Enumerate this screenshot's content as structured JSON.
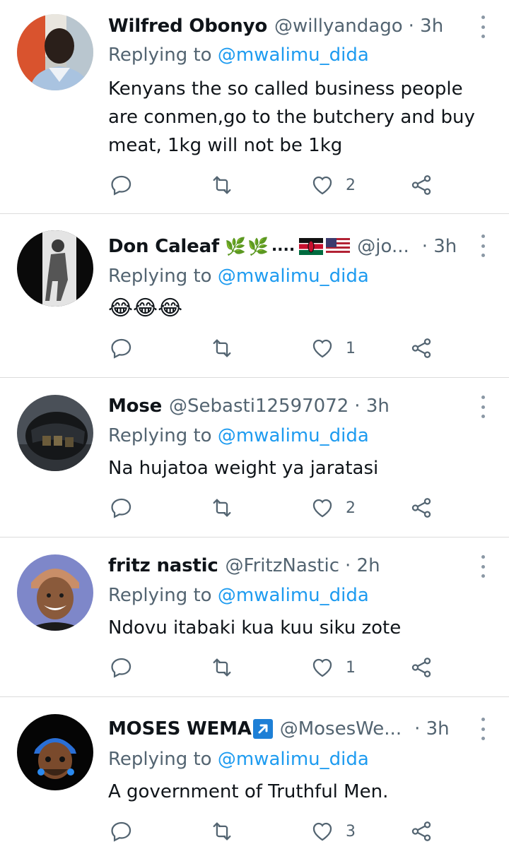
{
  "tweets": [
    {
      "display_name": "Wilfred Obonyo",
      "handle": "@willyandago",
      "time": "· 3h",
      "replying_label": "Replying to ",
      "replying_to": "@mwalimu_dida",
      "text": "Kenyans the so called business people are conmen,go to the butchery and buy meat, 1kg will not be 1kg",
      "likes": "2"
    },
    {
      "display_name": "Don Caleaf",
      "name_suffix": "....",
      "handle": "@jo...",
      "time": "· 3h",
      "replying_label": "Replying to ",
      "replying_to": "@mwalimu_dida",
      "text": "😂😂😂",
      "likes": "1"
    },
    {
      "display_name": "Mose",
      "handle": "@Sebasti12597072",
      "time": "· 3h",
      "replying_label": "Replying to ",
      "replying_to": "@mwalimu_dida",
      "text": "Na hujatoa weight ya jaratasi",
      "likes": "2"
    },
    {
      "display_name": "fritz nastic",
      "handle": "@FritzNastic",
      "time": "· 2h",
      "replying_label": "Replying to ",
      "replying_to": "@mwalimu_dida",
      "text": "Ndovu itabaki kua kuu siku zote",
      "likes": "1"
    },
    {
      "display_name": "MOSES WEMA",
      "handle": "@MosesWe...",
      "time": "· 3h",
      "replying_label": "Replying to ",
      "replying_to": "@mwalimu_dida",
      "text": "A government of Truthful Men.",
      "likes": "3"
    }
  ],
  "icons": {
    "reply": "reply-icon",
    "retweet": "retweet-icon",
    "like": "heart-icon",
    "share": "share-icon",
    "more": "more-options-icon"
  },
  "colors": {
    "mention": "#1d9bf0",
    "secondary_text": "#536471",
    "primary_text": "#0f1419",
    "divider": "#dcdcdc"
  }
}
